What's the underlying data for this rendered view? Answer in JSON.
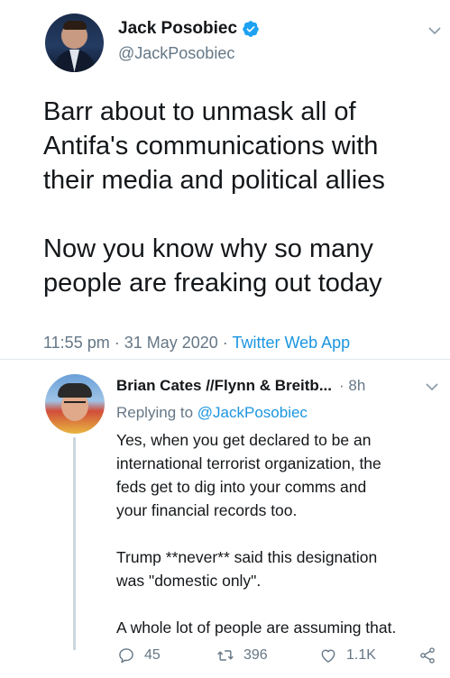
{
  "main_tweet": {
    "display_name": "Jack Posobiec",
    "handle": "@JackPosobiec",
    "verified": true,
    "text_lines": [
      "Barr about to unmask all of",
      "Antifa's communications with",
      "their media and political allies",
      "",
      "Now you know why so many",
      "people are freaking out today"
    ],
    "timestamp": "11:55 pm · 31 May 2020 · ",
    "source": "Twitter Web App"
  },
  "reply_tweet": {
    "display_name": "Brian Cates //Flynn & Breitb...",
    "time_ago": "· 8h",
    "replying_prefix": "Replying to ",
    "replying_to": "@JackPosobiec",
    "text_lines": [
      "Yes, when you get declared to be an",
      "international terrorist organization, the",
      "feds get to dig into your comms and",
      "your financial records too.",
      "",
      "Trump **never** said this designation",
      "was \"domestic only\".",
      "",
      "A whole lot of people are assuming that."
    ],
    "actions": {
      "replies": "45",
      "retweets": "396",
      "likes": "1.1K"
    }
  },
  "colors": {
    "link_blue": "#1b95e0",
    "secondary_gray": "#657786",
    "text_dark": "#14171a",
    "verified_blue": "#1da1f2"
  },
  "icons": {
    "verified": "verified-badge-icon",
    "more": "chevron-down-icon",
    "reply": "reply-icon",
    "retweet": "retweet-icon",
    "like": "heart-icon",
    "share": "share-icon"
  }
}
